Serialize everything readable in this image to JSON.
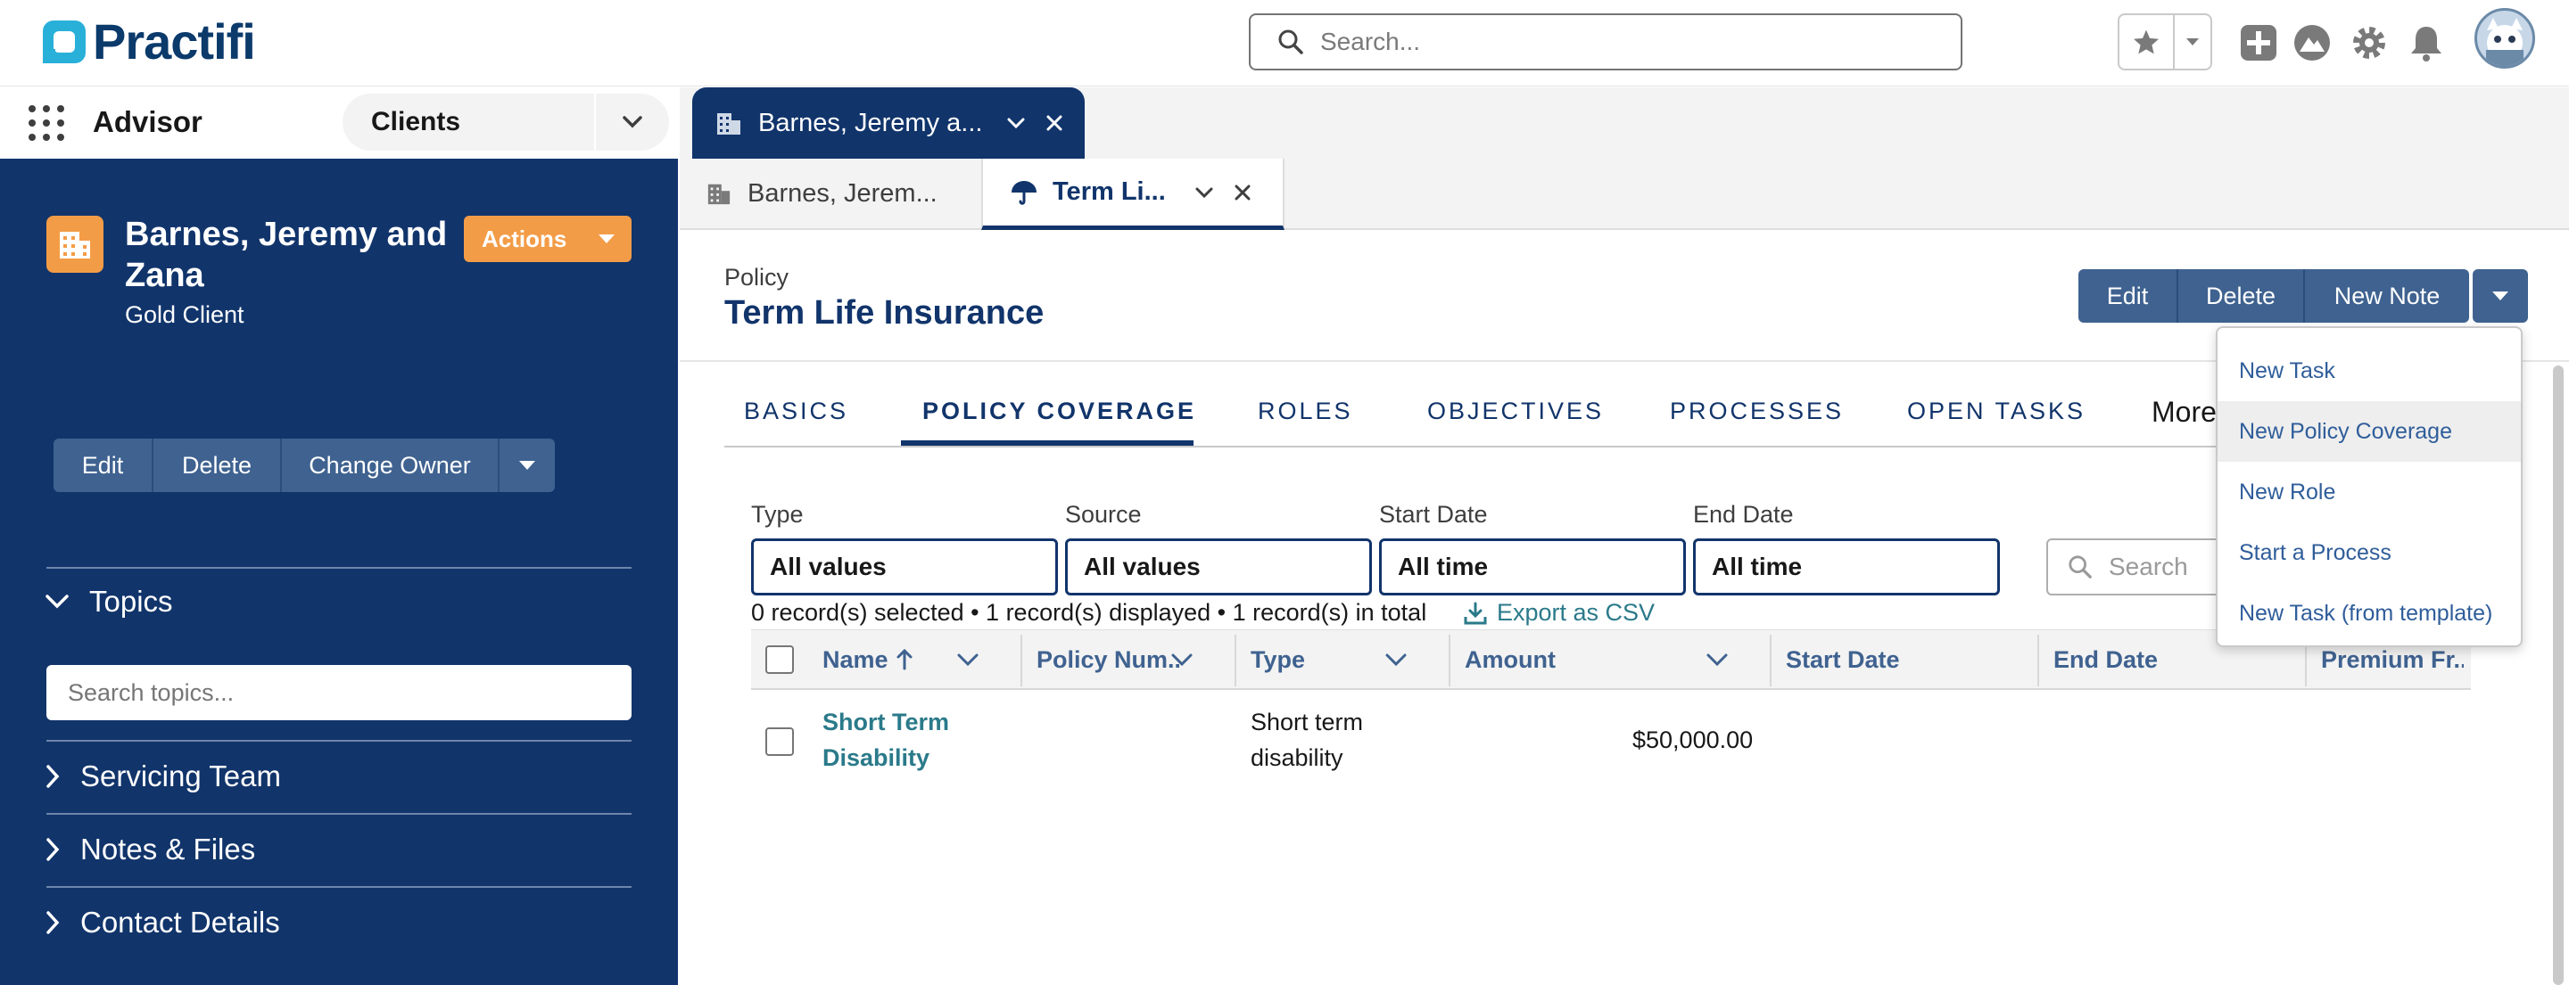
{
  "header": {
    "logo_text": "Practifi",
    "search_placeholder": "Search...",
    "icons": [
      "favorites-star-icon",
      "chevron-down-icon",
      "add-icon",
      "trailhead-icon",
      "gear-icon",
      "bell-icon",
      "avatar"
    ]
  },
  "nav": {
    "app_name": "Advisor",
    "object_menu": "Clients",
    "workspace_tab": "Barnes, Jeremy a..."
  },
  "record": {
    "name": "Barnes, Jeremy and Zana",
    "subtitle": "Gold Client",
    "actions_label": "Actions",
    "buttons": [
      "Edit",
      "Delete",
      "Change Owner"
    ]
  },
  "sidebar": {
    "topics": "Topics",
    "topic_search_placeholder": "Search topics...",
    "sections": [
      "Servicing Team",
      "Notes & Files",
      "Contact Details"
    ]
  },
  "subtabs": [
    {
      "label": "Barnes, Jerem...",
      "active": false
    },
    {
      "label": "Term Li...",
      "active": true
    }
  ],
  "policy": {
    "type_label": "Policy",
    "title": "Term Life Insurance",
    "buttons": [
      "Edit",
      "Delete",
      "New Note"
    ]
  },
  "tabs": [
    "BASICS",
    "POLICY COVERAGE",
    "ROLES",
    "OBJECTIVES",
    "PROCESSES",
    "OPEN TASKS"
  ],
  "more_label": "More",
  "filters": [
    {
      "label": "Type",
      "value": "All values"
    },
    {
      "label": "Source",
      "value": "All values"
    },
    {
      "label": "Start Date",
      "value": "All time"
    },
    {
      "label": "End Date",
      "value": "All time"
    }
  ],
  "table_search_placeholder": "Search",
  "summary": "0 record(s) selected • 1 record(s) displayed • 1 record(s) in total",
  "export_label": "Export as CSV",
  "table": {
    "columns": [
      "Name",
      "Policy Num...",
      "Type",
      "Amount",
      "Start Date",
      "End Date",
      "Premium Fr..."
    ],
    "rows": [
      {
        "name_line1": "Short Term",
        "name_line2": "Disability",
        "policy_num": "",
        "type_line1": "Short term",
        "type_line2": "disability",
        "amount": "$50,000.00",
        "start": "",
        "end": ""
      }
    ]
  },
  "dropdown": {
    "items": [
      "New Task",
      "New Policy Coverage",
      "New Role",
      "Start a Process",
      "New Task (from template)"
    ],
    "highlighted": "New Policy Coverage"
  },
  "colors": {
    "navy": "#11346b",
    "orange": "#f39c47",
    "button_blue": "#3f6290",
    "link_teal": "#2a7a8a"
  }
}
